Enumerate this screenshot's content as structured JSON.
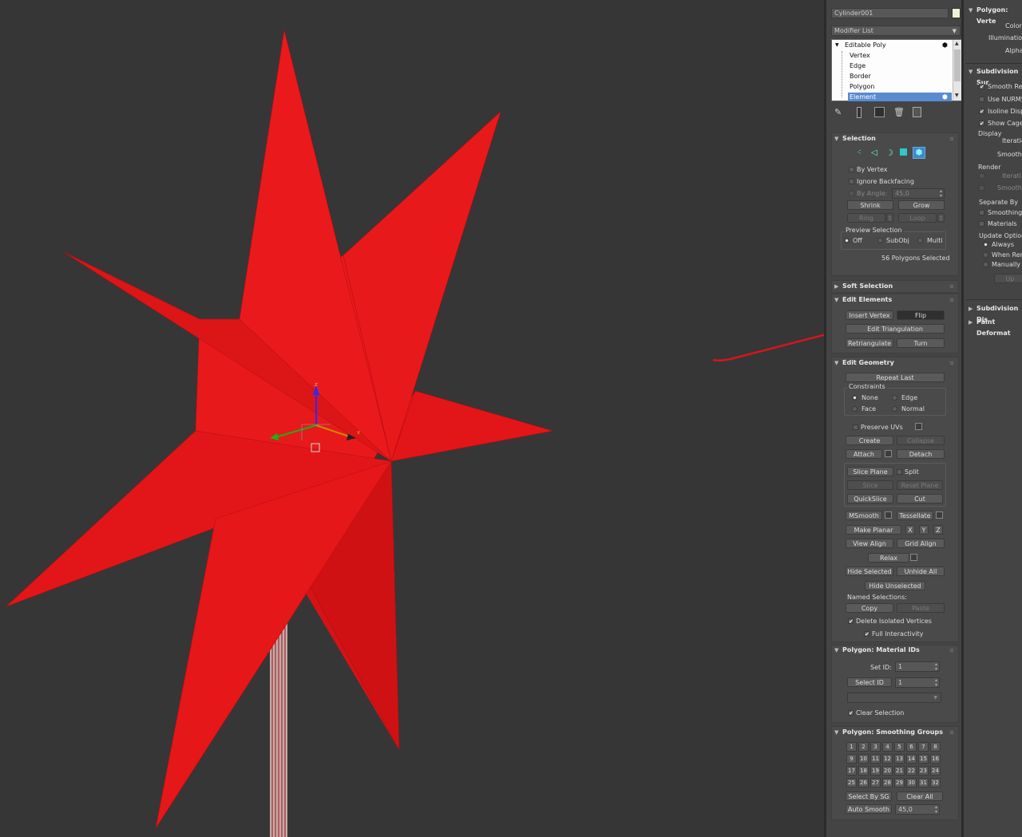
{
  "object_name": "Cylinder001",
  "object_color": "#f0f0d8",
  "modifier_list_label": "Modifier List",
  "stack": {
    "items": [
      "Editable Poly",
      "Vertex",
      "Edge",
      "Border",
      "Polygon",
      "Element"
    ],
    "selected": "Element"
  },
  "selection": {
    "title": "Selection",
    "by_vertex": "By Vertex",
    "ignore_backfacing": "Ignore Backfacing",
    "by_angle": "By Angle:",
    "by_angle_value": "45,0",
    "shrink": "Shrink",
    "grow": "Grow",
    "ring": "Ring",
    "loop": "Loop",
    "preview_label": "Preview Selection",
    "preview_off": "Off",
    "preview_subobj": "SubObj",
    "preview_multi": "Multi",
    "status": "56 Polygons Selected"
  },
  "soft_selection": {
    "title": "Soft Selection"
  },
  "edit_elements": {
    "title": "Edit Elements",
    "insert_vertex": "Insert Vertex",
    "flip": "Flip",
    "edit_triangulation": "Edit Triangulation",
    "retriangulate": "Retriangulate",
    "turn": "Turn"
  },
  "edit_geometry": {
    "title": "Edit Geometry",
    "repeat_last": "Repeat Last",
    "constraints": "Constraints",
    "none": "None",
    "edge": "Edge",
    "face": "Face",
    "normal": "Normal",
    "preserve_uvs": "Preserve UVs",
    "create": "Create",
    "collapse": "Collapse",
    "attach": "Attach",
    "detach": "Detach",
    "slice_plane": "Slice Plane",
    "split": "Split",
    "slice": "Slice",
    "reset_plane": "Reset Plane",
    "quickslice": "QuickSlice",
    "cut": "Cut",
    "msmooth": "MSmooth",
    "tessellate": "Tessellate",
    "make_planar": "Make Planar",
    "x": "X",
    "y": "Y",
    "z": "Z",
    "view_align": "View Align",
    "grid_align": "Grid Align",
    "relax": "Relax",
    "hide_selected": "Hide Selected",
    "unhide_all": "Unhide All",
    "hide_unselected": "Hide Unselected",
    "named_selections": "Named Selections:",
    "copy": "Copy",
    "paste": "Paste",
    "delete_isolated": "Delete Isolated Vertices",
    "full_interactivity": "Full Interactivity"
  },
  "material_ids": {
    "title": "Polygon: Material IDs",
    "set_id": "Set ID:",
    "set_id_value": "1",
    "select_id": "Select ID",
    "select_id_value": "1",
    "clear_selection": "Clear Selection"
  },
  "smoothing_groups": {
    "title": "Polygon: Smoothing Groups",
    "numbers": [
      "1",
      "2",
      "3",
      "4",
      "5",
      "6",
      "7",
      "8",
      "9",
      "10",
      "11",
      "12",
      "13",
      "14",
      "15",
      "16",
      "17",
      "18",
      "19",
      "20",
      "21",
      "22",
      "23",
      "24",
      "25",
      "26",
      "27",
      "28",
      "29",
      "30",
      "31",
      "32"
    ],
    "select_by_sg": "Select By SG",
    "clear_all": "Clear All",
    "auto_smooth": "Auto Smooth",
    "auto_smooth_value": "45,0"
  },
  "right_panel": {
    "vertex_colors_title": "Polygon: Verte",
    "color": "Color",
    "illumination": "Illumination",
    "alpha": "Alpha",
    "subdivision_title": "Subdivision Sur",
    "smooth_result": "Smooth Res",
    "use_nurms": "Use NURMS",
    "isoline_display": "Isoline Displ",
    "show_cage": "Show Cage.",
    "display": "Display",
    "iterations": "Iteratio",
    "smoothness": "Smoothne",
    "render": "Render",
    "render_iterations": "Iterati",
    "render_smoothness": "Smoothn",
    "separate_by": "Separate By",
    "smoothing_groups": "Smoothing G",
    "materials": "Materials",
    "update_options": "Update Options",
    "always": "Always",
    "when_rendering": "When Rend",
    "manually": "Manually",
    "update_btn": "Up",
    "subdivision_displacement": "Subdivision Dis",
    "paint_deformation": "Paint Deformat"
  },
  "colors": {
    "star_base": "#e8191b",
    "star_dark": "#c81012",
    "annotation": "#d8141c",
    "selected_item": "#5a8ad0"
  }
}
